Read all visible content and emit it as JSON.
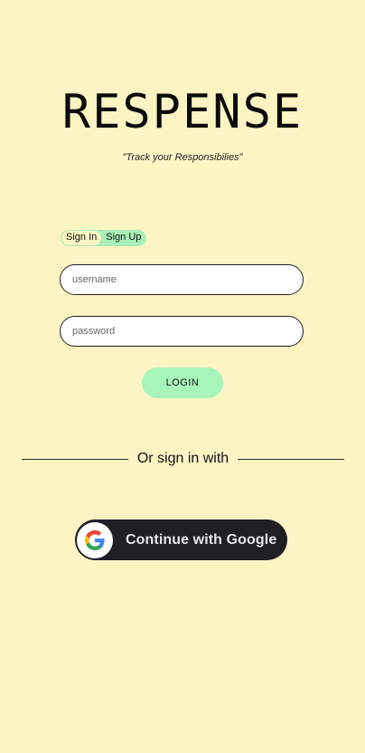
{
  "app": {
    "title": "RESPENSE",
    "tagline": "\"Track your Responsibilies\""
  },
  "auth_toggle": {
    "options": [
      "Sign In",
      "Sign Up"
    ],
    "selected": "Sign In"
  },
  "form": {
    "username_placeholder": "username",
    "username_value": "",
    "password_placeholder": "password",
    "password_value": "",
    "login_label": "LOGIN"
  },
  "divider": {
    "text": "Or sign in with"
  },
  "google": {
    "label": "Continue with Google",
    "icon": "google-g-icon"
  },
  "colors": {
    "background": "#fdf4c4",
    "accent_green": "#a8f5b9",
    "google_button": "#1f1f24"
  }
}
